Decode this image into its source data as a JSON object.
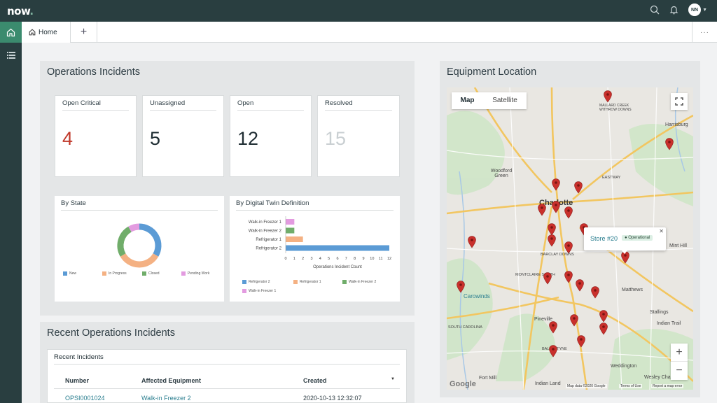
{
  "app": {
    "logo_text": "now"
  },
  "header": {
    "user_initials": "NN"
  },
  "tabs": [
    {
      "label": "Home"
    }
  ],
  "ops_panel": {
    "title": "Operations Incidents"
  },
  "kpis": [
    {
      "label": "Open Critical",
      "value": "4",
      "color": "#c0392b"
    },
    {
      "label": "Unassigned",
      "value": "5",
      "color": "#1f2d33"
    },
    {
      "label": "Open",
      "value": "12",
      "color": "#1f2d33"
    },
    {
      "label": "Resolved",
      "value": "15",
      "color": "#c9cfd2"
    }
  ],
  "by_state": {
    "title": "By State",
    "legend": [
      "New",
      "In Progress",
      "Closed",
      "Pending Work"
    ],
    "colors": [
      "#5b9bd5",
      "#f4b183",
      "#70ad6a",
      "#e39be0"
    ],
    "values": [
      4,
      4,
      3,
      1
    ]
  },
  "by_twin": {
    "title": "By Digital Twin Definition",
    "xlabel": "Operations Incident Count",
    "ticks": [
      "0",
      "1",
      "2",
      "3",
      "4",
      "5",
      "6",
      "7",
      "8",
      "9",
      "10",
      "11",
      "12"
    ],
    "legend": [
      "Refrigerator 2",
      "Refrigerator 1",
      "Walk-in Freezer 2",
      "Walk-in Freezer 1"
    ]
  },
  "chart_data": {
    "type": "bar",
    "orientation": "horizontal",
    "categories": [
      "Walk-in Freezer 1",
      "Walk-in Freezer 2",
      "Refrigerator 1",
      "Refrigerator 2"
    ],
    "values": [
      1,
      1,
      2,
      12
    ],
    "colors": [
      "#e39be0",
      "#70ad6a",
      "#f4b183",
      "#5b9bd5"
    ],
    "xlabel": "Operations Incident Count",
    "xlim": [
      0,
      12
    ]
  },
  "recent": {
    "panel_title": "Recent Operations Incidents",
    "card_title": "Recent Incidents",
    "columns": [
      "Number",
      "Affected Equipment",
      "Created"
    ],
    "rows": [
      {
        "number": "OPSI0001024",
        "equipment": "Walk-in Freezer 2",
        "created": "2020-10-13 12:32:07"
      }
    ]
  },
  "map": {
    "title": "Equipment Location",
    "map_btn": "Map",
    "satellite_btn": "Satellite",
    "city": "Charlotte",
    "popup_title": "Store #20",
    "popup_status": "Operational",
    "labels": [
      "Harrisburg",
      "Woodford Green",
      "EASTWAY",
      "Mint Hill",
      "Matthews",
      "Stallings",
      "Indian Trail",
      "Pineville",
      "Weddington",
      "Wesley Chapel",
      "Fort Mill",
      "Indian Land",
      "BARCLAY DOWNS",
      "MONTCLAIRE SOUTH",
      "BALLANTYNE",
      "Carowinds",
      "MALLARD CREEK WITHROW DOWNS",
      "SOUTH CAROLINA"
    ],
    "footer": [
      "Map data ©2020 Google",
      "Terms of Use",
      "Report a map error"
    ],
    "google": "Google"
  }
}
